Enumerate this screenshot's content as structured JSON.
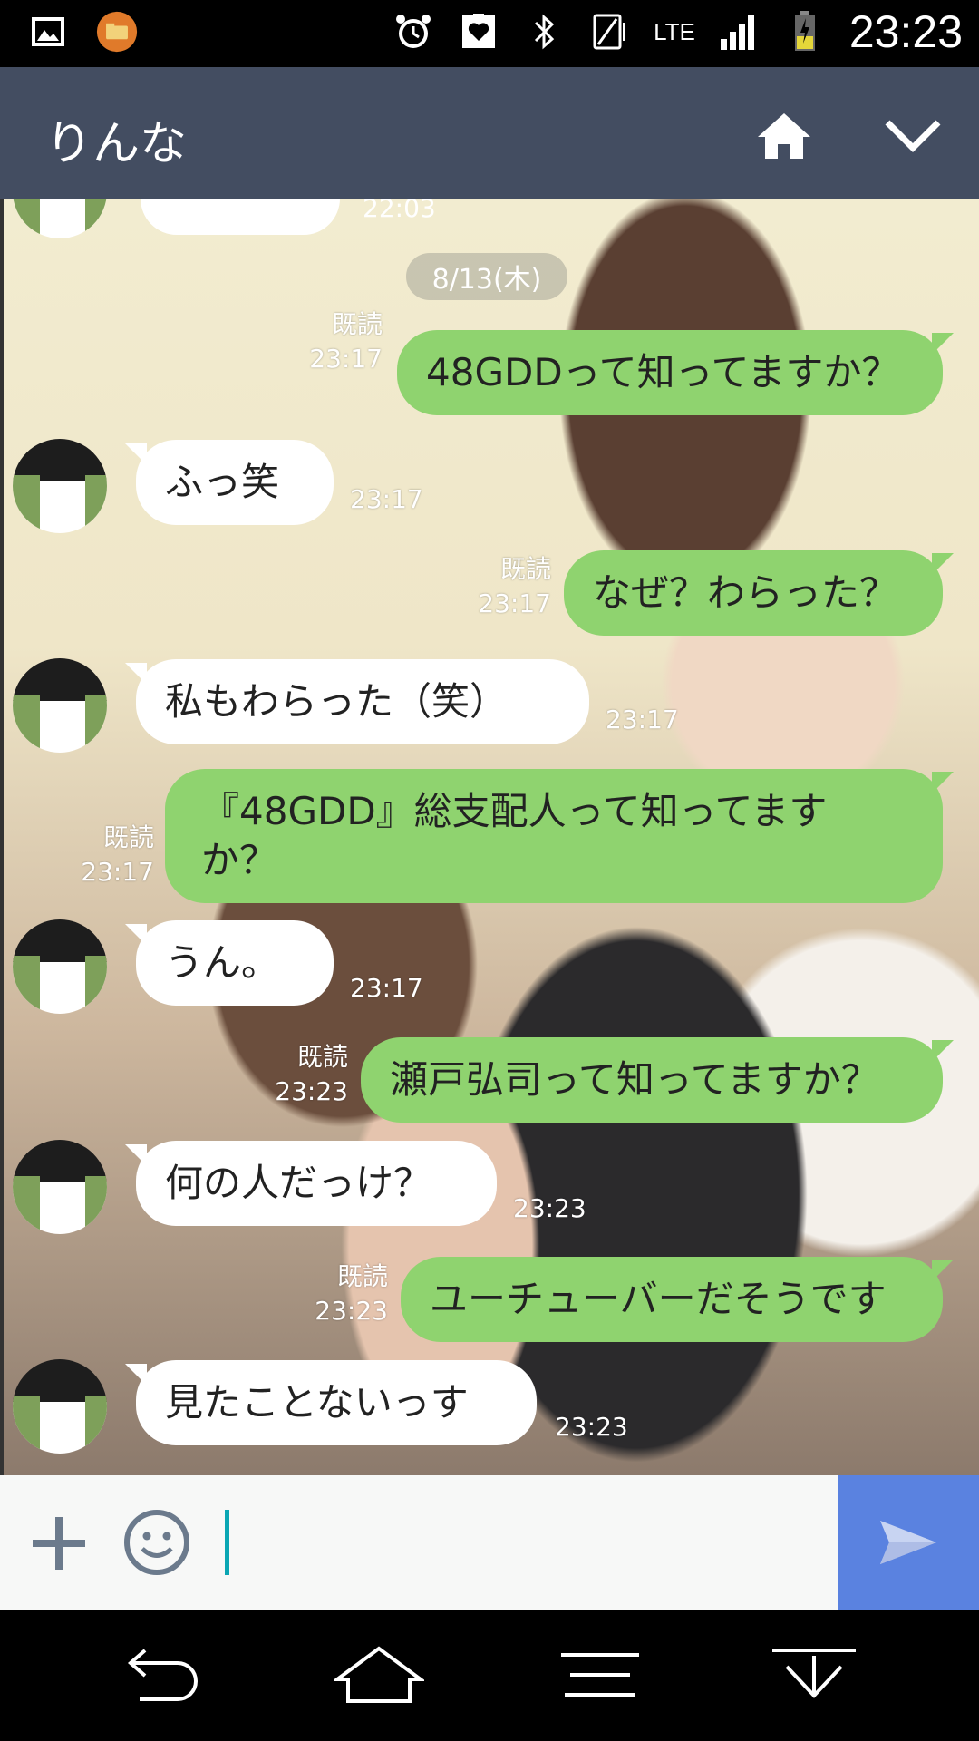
{
  "status_bar": {
    "time": "23:23",
    "network": "LTE",
    "left_icons": [
      "gallery-icon",
      "file-manager-icon"
    ],
    "right_icons": [
      "alarm-icon",
      "heart-badge-icon",
      "bluetooth-icon",
      "vibrate-icon",
      "signal-icon",
      "battery-icon"
    ]
  },
  "header": {
    "title": "りんな",
    "buttons": [
      "home-icon",
      "chevron-down-icon"
    ]
  },
  "chat": {
    "date_label": "8/13(木)",
    "partial_top_time": "22:03",
    "messages": [
      {
        "side": "out",
        "text": "48GDDって知ってますか？",
        "read": "既読",
        "time": "23:17"
      },
      {
        "side": "in",
        "text": "ふっ笑",
        "time": "23:17"
      },
      {
        "side": "out",
        "text": "なぜ？わらった？",
        "read": "既読",
        "time": "23:17"
      },
      {
        "side": "in",
        "text": "私もわらった（笑）",
        "time": "23:17"
      },
      {
        "side": "out",
        "text_line1": "『48GDD』総支配人って知ってます",
        "text_line2": "か？",
        "read": "既読",
        "time": "23:17"
      },
      {
        "side": "in",
        "text": "うん。",
        "time": "23:17"
      },
      {
        "side": "out",
        "text": "瀬戸弘司って知ってますか？",
        "read": "既読",
        "time": "23:23"
      },
      {
        "side": "in",
        "text": "何の人だっけ？",
        "time": "23:23"
      },
      {
        "side": "out",
        "text": "ユーチューバーだそうです",
        "read": "既読",
        "time": "23:23"
      },
      {
        "side": "in",
        "text": "見たことないっす",
        "time": "23:23"
      }
    ]
  },
  "input_bar": {
    "value": "",
    "icons": [
      "plus-icon",
      "emoji-icon",
      "send-icon"
    ],
    "send_color": "#5a82e0"
  },
  "nav_bar": {
    "buttons": [
      "back-icon",
      "home-outline-icon",
      "menu-icon",
      "collapse-icon"
    ]
  },
  "colors": {
    "header_bg": "#434d61",
    "bubble_out": "#8fd36f",
    "bubble_in": "#ffffff"
  }
}
